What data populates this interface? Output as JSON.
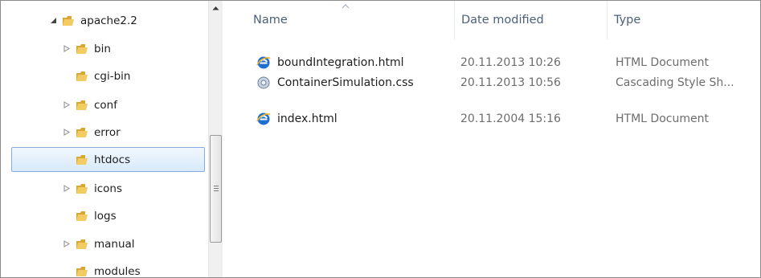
{
  "tree": {
    "items": [
      {
        "label": "apache2.2",
        "expander": "expanded",
        "selected": false
      },
      {
        "label": "bin",
        "expander": "collapsed",
        "selected": false
      },
      {
        "label": "cgi-bin",
        "expander": "none",
        "selected": false
      },
      {
        "label": "conf",
        "expander": "collapsed",
        "selected": false
      },
      {
        "label": "error",
        "expander": "collapsed",
        "selected": false
      },
      {
        "label": "htdocs",
        "expander": "none",
        "selected": true
      },
      {
        "label": "icons",
        "expander": "collapsed",
        "selected": false
      },
      {
        "label": "logs",
        "expander": "none",
        "selected": false
      },
      {
        "label": "manual",
        "expander": "collapsed",
        "selected": false
      },
      {
        "label": "modules",
        "expander": "none",
        "selected": false
      }
    ]
  },
  "list": {
    "columns": {
      "name": "Name",
      "date": "Date modified",
      "type": "Type"
    },
    "sort": {
      "column": "name",
      "direction": "ascending"
    },
    "files": [
      {
        "name": "boundIntegration.html",
        "date": "20.11.2013 10:26",
        "type": "HTML Document",
        "icon": "ie-html-icon"
      },
      {
        "name": "ContainerSimulation.css",
        "date": "20.11.2013 10:56",
        "type": "Cascading Style Sh...",
        "icon": "css-file-icon"
      },
      {
        "name": "index.html",
        "date": "20.11.2004 15:16",
        "type": "HTML Document",
        "icon": "ie-html-icon"
      }
    ]
  },
  "colors": {
    "folder": "#e8b84a",
    "selection_border": "#84acdd",
    "header_text": "#4c607a",
    "ie_blue": "#1f6fd1"
  }
}
